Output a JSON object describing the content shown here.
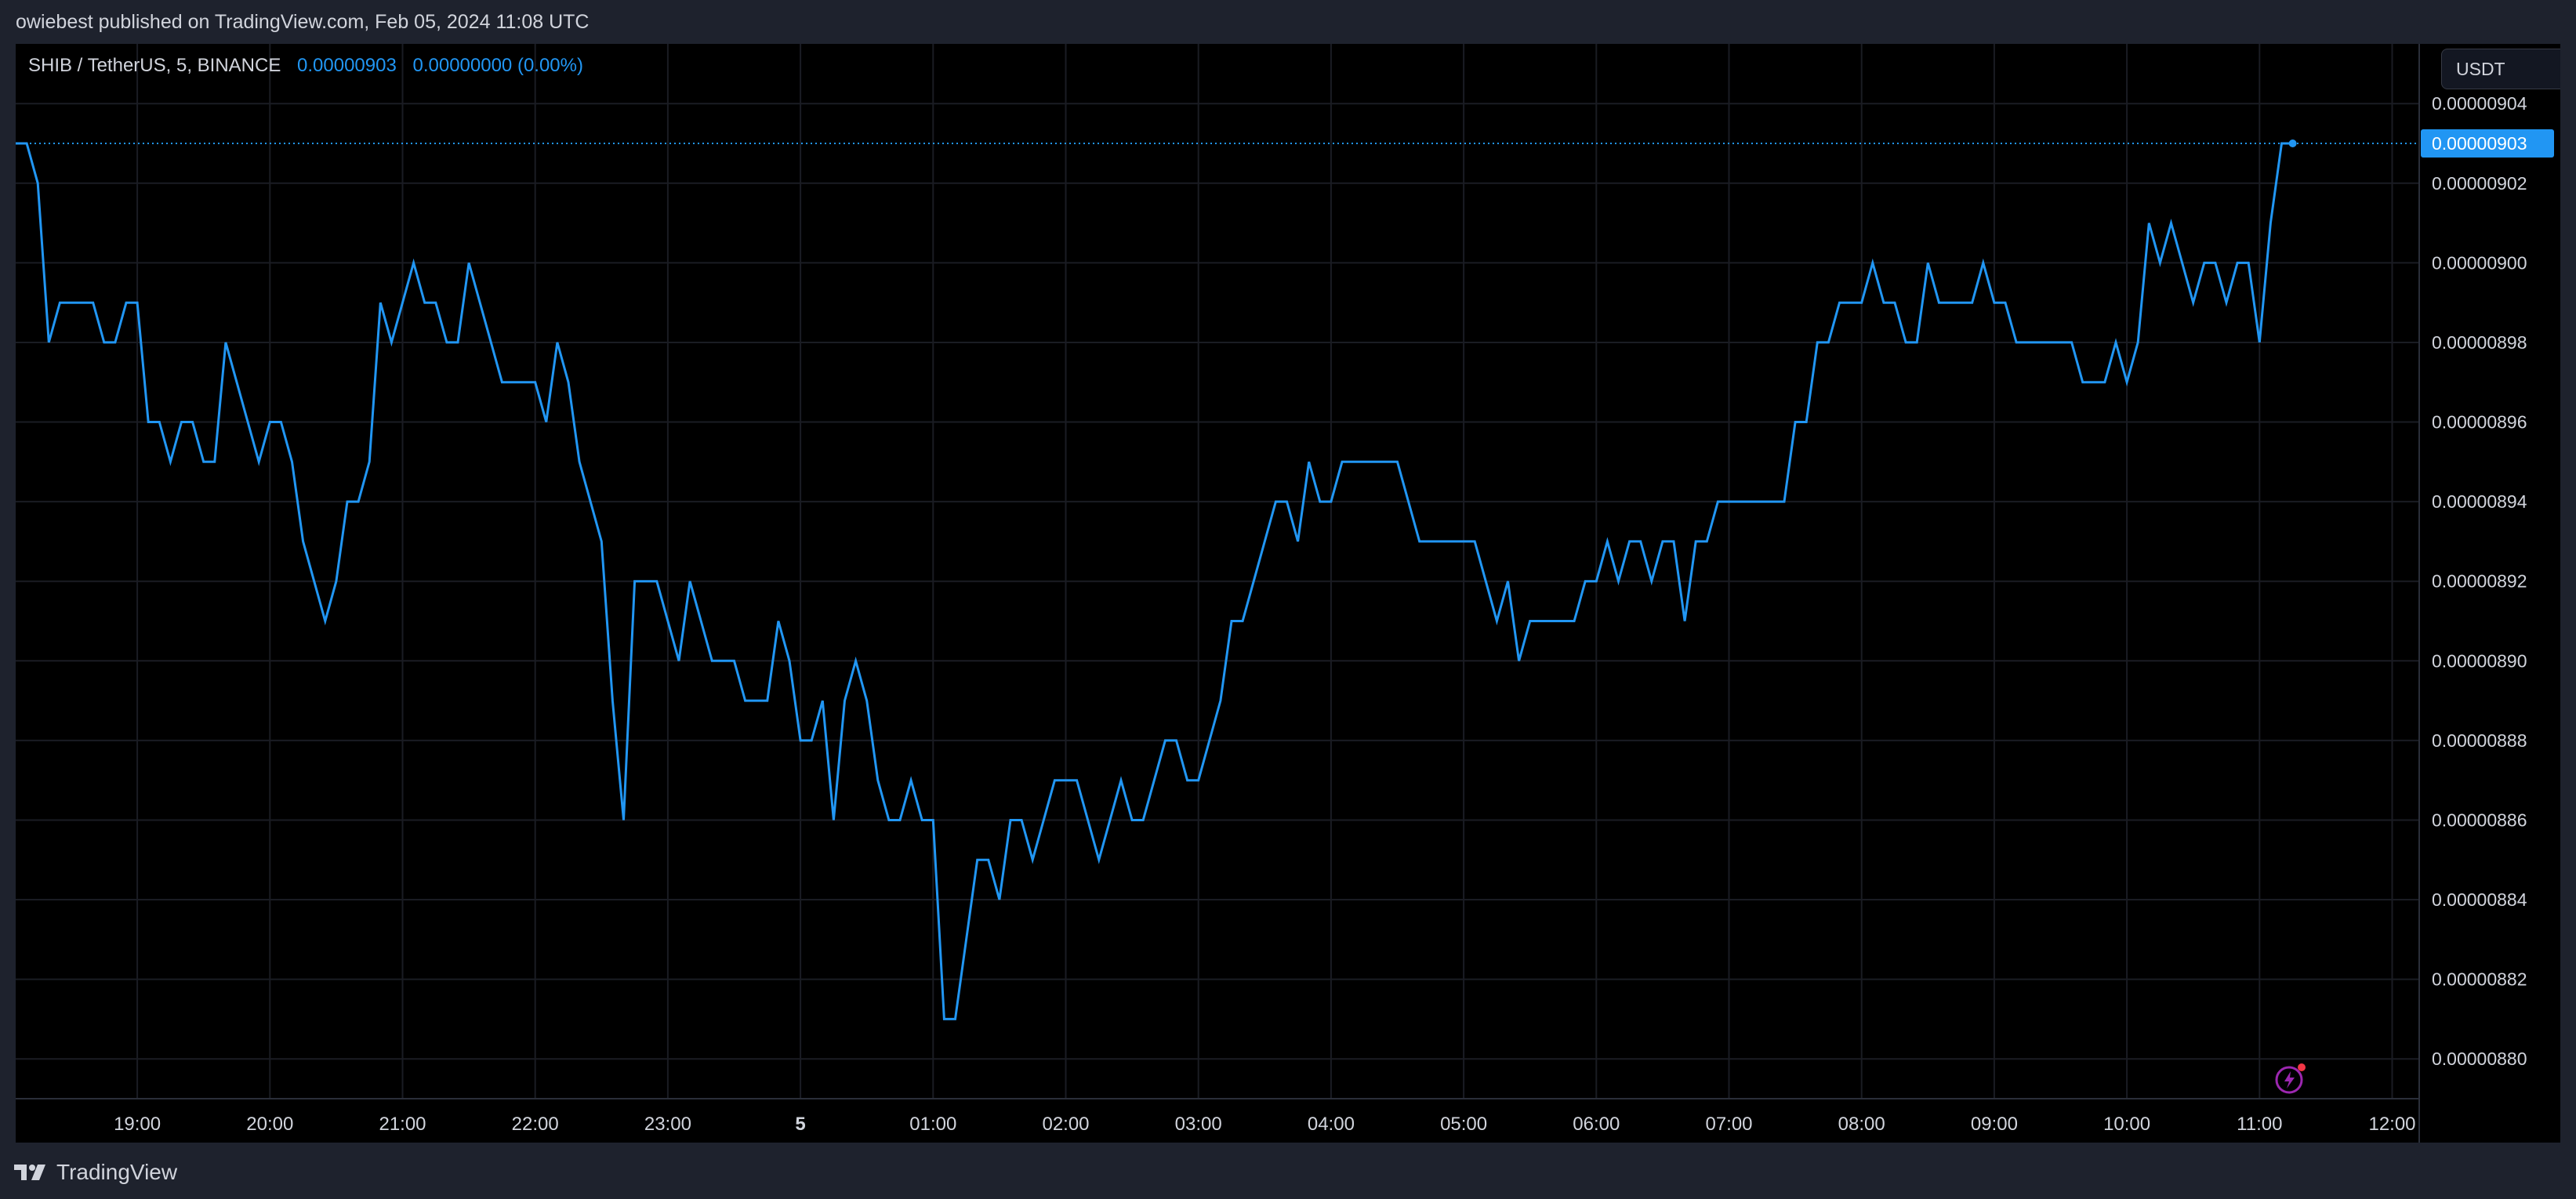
{
  "header": {
    "publish_text": "owiebest published on TradingView.com, Feb 05, 2024 11:08 UTC"
  },
  "legend": {
    "symbol": "SHIB / TetherUS, 5, BINANCE",
    "last": "0.00000903",
    "change": "0.00000000 (0.00%)"
  },
  "currency_button": "USDT",
  "price_label": "0.00000903",
  "footer": {
    "brand": "TradingView"
  },
  "colors": {
    "line": "#2196f3",
    "background": "#000000",
    "frame": "#1e222d",
    "grid": "#1a1c23",
    "text": "#d1d4dc"
  },
  "icons": [
    "lightning-icon",
    "tradingview-logo-icon"
  ],
  "chart_data": {
    "type": "line",
    "title": "SHIB / TetherUS, 5, BINANCE",
    "x_start": "Feb 04, 18:05 UTC",
    "x_interval_minutes": 5,
    "x_ticks": [
      {
        "label": "19:00",
        "index": 11
      },
      {
        "label": "20:00",
        "index": 23
      },
      {
        "label": "21:00",
        "index": 35
      },
      {
        "label": "22:00",
        "index": 47
      },
      {
        "label": "23:00",
        "index": 59
      },
      {
        "label": "5",
        "index": 71,
        "bold": true
      },
      {
        "label": "01:00",
        "index": 83
      },
      {
        "label": "02:00",
        "index": 95
      },
      {
        "label": "03:00",
        "index": 107
      },
      {
        "label": "04:00",
        "index": 119
      },
      {
        "label": "05:00",
        "index": 131
      },
      {
        "label": "06:00",
        "index": 143
      },
      {
        "label": "07:00",
        "index": 155
      },
      {
        "label": "08:00",
        "index": 167
      },
      {
        "label": "09:00",
        "index": 179
      },
      {
        "label": "10:00",
        "index": 191
      },
      {
        "label": "11:00",
        "index": 203
      },
      {
        "label": "12:00",
        "index": 215
      }
    ],
    "y_ticks": [
      "0.00000904",
      "0.00000902",
      "0.00000900",
      "0.00000898",
      "0.00000896",
      "0.00000894",
      "0.00000892",
      "0.00000890",
      "0.00000888",
      "0.00000886",
      "0.00000884",
      "0.00000882",
      "0.00000880"
    ],
    "ylim": [
      8.79e-06,
      9.055e-06
    ],
    "y_unit": "1e-8",
    "values": [
      903,
      903,
      902,
      898,
      899,
      899,
      899,
      899,
      898,
      898,
      899,
      899,
      896,
      896,
      895,
      896,
      896,
      895,
      895,
      898,
      897,
      896,
      895,
      896,
      896,
      895,
      893,
      892,
      891,
      892,
      894,
      894,
      895,
      899,
      898,
      899,
      900,
      899,
      899,
      898,
      898,
      900,
      899,
      898,
      897,
      897,
      897,
      897,
      896,
      898,
      897,
      895,
      894,
      893,
      889,
      886,
      892,
      892,
      892,
      891,
      890,
      892,
      891,
      890,
      890,
      890,
      889,
      889,
      889,
      891,
      890,
      888,
      888,
      889,
      886,
      889,
      890,
      889,
      887,
      886,
      886,
      887,
      886,
      886,
      881,
      881,
      883,
      885,
      885,
      884,
      886,
      886,
      885,
      886,
      887,
      887,
      887,
      886,
      885,
      886,
      887,
      886,
      886,
      887,
      888,
      888,
      887,
      887,
      888,
      889,
      891,
      891,
      892,
      893,
      894,
      894,
      893,
      895,
      894,
      894,
      895,
      895,
      895,
      895,
      895,
      895,
      894,
      893,
      893,
      893,
      893,
      893,
      893,
      892,
      891,
      892,
      890,
      891,
      891,
      891,
      891,
      891,
      892,
      892,
      893,
      892,
      893,
      893,
      892,
      893,
      893,
      891,
      893,
      893,
      894,
      894,
      894,
      894,
      894,
      894,
      894,
      896,
      896,
      898,
      898,
      899,
      899,
      899,
      900,
      899,
      899,
      898,
      898,
      900,
      899,
      899,
      899,
      899,
      900,
      899,
      899,
      898,
      898,
      898,
      898,
      898,
      898,
      897,
      897,
      897,
      898,
      897,
      898,
      901,
      900,
      901,
      900,
      899,
      900,
      900,
      899,
      900,
      900,
      898,
      901,
      903,
      903
    ],
    "last_value": "0.00000903",
    "grid": true,
    "legend": "top-left"
  }
}
